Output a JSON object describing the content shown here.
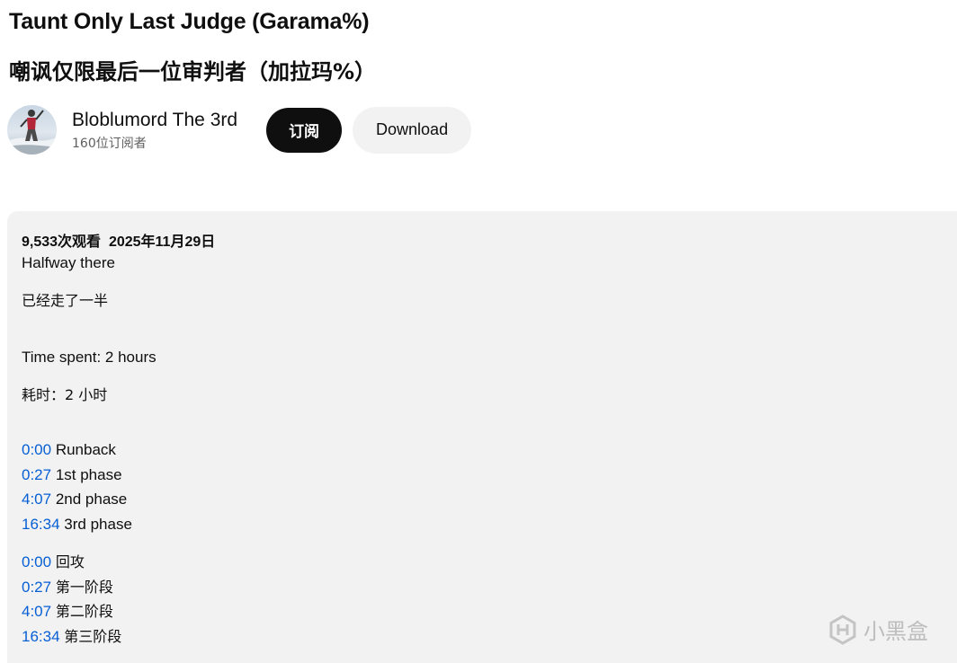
{
  "video": {
    "title_en": "Taunt Only Last Judge (Garama%)",
    "title_zh": "嘲讽仅限最后一位审判者（加拉玛%）"
  },
  "channel": {
    "name": "Bloblumord The 3rd",
    "subscribers": "160位订阅者"
  },
  "actions": {
    "subscribe_label": "订阅",
    "download_label": "Download"
  },
  "description": {
    "views": "9,533次观看",
    "date": "2025年11月29日",
    "line1_en": "Halfway there",
    "line1_zh": "已经走了一半",
    "time_en": "Time spent: 2 hours",
    "time_zh": "耗时：2 小时",
    "chapters_en": [
      {
        "time": "0:00",
        "label": "Runback"
      },
      {
        "time": "0:27",
        "label": "1st phase"
      },
      {
        "time": "4:07",
        "label": "2nd phase"
      },
      {
        "time": "16:34",
        "label": "3rd phase"
      }
    ],
    "chapters_zh": [
      {
        "time": "0:00",
        "label": "回攻"
      },
      {
        "time": "0:27",
        "label": "第一阶段"
      },
      {
        "time": "4:07",
        "label": "第二阶段"
      },
      {
        "time": "16:34",
        "label": "第三阶段"
      }
    ]
  },
  "watermark": {
    "text": "小黑盒",
    "icon": "heybox-logo-icon"
  },
  "colors": {
    "link": "#065fd4",
    "subscribe_bg": "#0f0f0f",
    "download_bg": "#f2f2f2",
    "description_bg": "#f2f2f2"
  }
}
